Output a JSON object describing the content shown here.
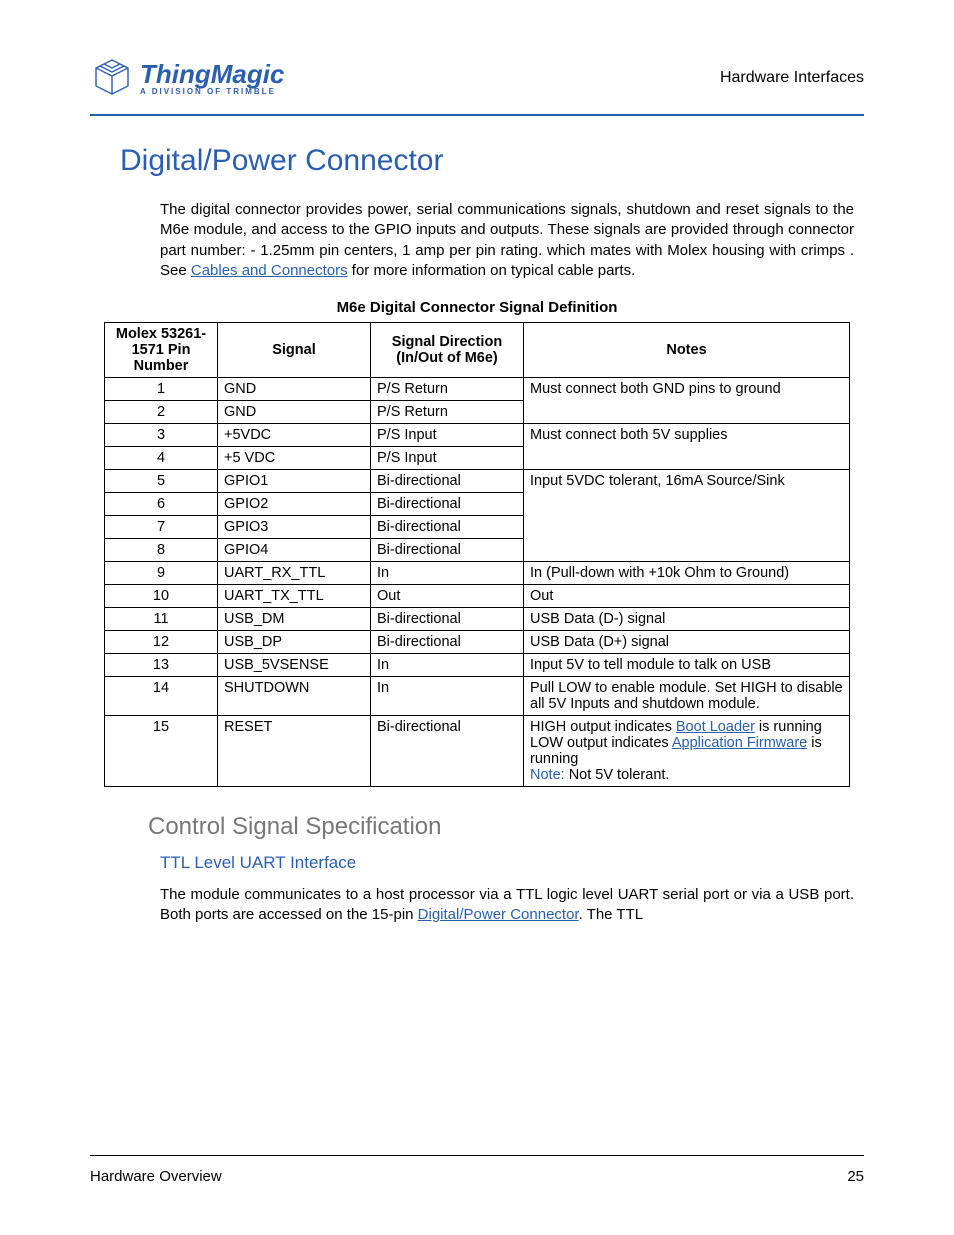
{
  "header": {
    "logo_main": "ThingMagic",
    "logo_sub": "A DIVISION OF TRIMBLE",
    "right": "Hardware Interfaces"
  },
  "title": "Digital/Power Connector",
  "intro": {
    "p1a": "The digital connector provides power, serial communications signals, shutdown and reset signals to the M6e module, and access to the GPIO inputs and outputs. These signals are provided through connector part number:",
    "p1b": " - 1.25mm pin centers, 1 amp per pin rating. which mates with Molex housing ",
    "p1c": " with crimps ",
    "p1d": ". See ",
    "link1": "Cables and Connectors",
    "p1e": " for more information on typical cable parts."
  },
  "table": {
    "caption": "M6e Digital Connector Signal Definition",
    "headers": {
      "pin": "Molex 53261-1571 Pin Number",
      "signal": "Signal",
      "direction": "Signal Direction (In/Out of M6e)",
      "notes": "Notes"
    },
    "rows": [
      {
        "pin": "1",
        "signal": "GND",
        "dir": "P/S Return",
        "note": "Must connect both GND pins to ground",
        "merge": "start"
      },
      {
        "pin": "2",
        "signal": "GND",
        "dir": "P/S Return",
        "note": "",
        "merge": "end"
      },
      {
        "pin": "3",
        "signal": "+5VDC",
        "dir": "P/S Input",
        "note": "Must connect both 5V supplies",
        "merge": "start"
      },
      {
        "pin": "4",
        "signal": "+5 VDC",
        "dir": "P/S Input",
        "note": "",
        "merge": "end"
      },
      {
        "pin": "5",
        "signal": "GPIO1",
        "dir": "Bi-directional",
        "note": "Input 5VDC tolerant, 16mA Source/Sink",
        "merge": "start"
      },
      {
        "pin": "6",
        "signal": "GPIO2",
        "dir": "Bi-directional",
        "note": "",
        "merge": "mid"
      },
      {
        "pin": "7",
        "signal": "GPIO3",
        "dir": "Bi-directional",
        "note": "",
        "merge": "mid"
      },
      {
        "pin": "8",
        "signal": "GPIO4",
        "dir": "Bi-directional",
        "note": "",
        "merge": "end"
      },
      {
        "pin": "9",
        "signal": "UART_RX_TTL",
        "dir": "In",
        "note": "In (Pull-down with +10k Ohm to Ground)"
      },
      {
        "pin": "10",
        "signal": "UART_TX_TTL",
        "dir": "Out",
        "note": "Out"
      },
      {
        "pin": "11",
        "signal": "USB_DM",
        "dir": "Bi-directional",
        "note": "USB Data (D-) signal"
      },
      {
        "pin": "12",
        "signal": "USB_DP",
        "dir": "Bi-directional",
        "note": "USB Data (D+) signal"
      },
      {
        "pin": "13",
        "signal": "USB_5VSENSE",
        "dir": "In",
        "note": "Input 5V to tell module to talk on USB"
      },
      {
        "pin": "14",
        "signal": "SHUTDOWN",
        "dir": "In",
        "note": "Pull LOW to enable module. Set HIGH to disable all 5V Inputs and shutdown module."
      },
      {
        "pin": "15",
        "signal": "RESET",
        "dir": "Bi-directional",
        "note_special": true,
        "n1": "HIGH output indicates ",
        "l1": "Boot Loader",
        "n2": " is running LOW output indicates ",
        "l2": "Application Firmware",
        "n3": " is running",
        "nlabel": "Note:",
        "n4": "  Not 5V tolerant."
      }
    ]
  },
  "section2": {
    "h2": "Control Signal Specification",
    "h3": "TTL Level UART Interface",
    "p1a": "The module communicates to a host processor via a TTL logic level UART serial port or via a USB port. Both ports are accessed on the 15-pin ",
    "link": "Digital/Power Connector",
    "p1b": ". The TTL"
  },
  "footer": {
    "left": "Hardware Overview",
    "right": "25"
  }
}
